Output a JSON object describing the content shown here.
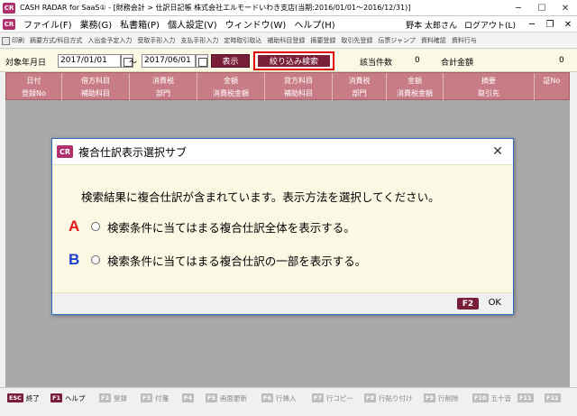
{
  "window": {
    "icon_text": "CR",
    "title": "CASH RADAR for SaaS① - [財務会計 > 仕訳日記帳 株式会社エルモードいわき支店(当期:2016/01/01～2016/12/31)]",
    "minimize": "─",
    "maximize": "☐",
    "close": "✕"
  },
  "menu": {
    "items": [
      "ファイル(F)",
      "業務(G)",
      "私書箱(P)",
      "個人設定(V)",
      "ウィンドウ(W)",
      "ヘルプ(H)"
    ],
    "user": "野本 太郎さん",
    "logout": "ログアウト(L)",
    "min": "─",
    "restore": "❐",
    "close": "✕"
  },
  "toolbar": {
    "items": [
      "印刷",
      "摘要方式/科目方式",
      "入出金予定入力",
      "受取手形入力",
      "支払手形入力",
      "定時取引取込",
      "補助科目登録",
      "摘要登録",
      "取引先登録",
      "伝票ジャンプ",
      "資料確認",
      "資料行与"
    ]
  },
  "search": {
    "period_label": "対象年月日",
    "date_from": "2017/01/01",
    "tilde": "～",
    "date_to": "2017/06/01",
    "display_button": "表示",
    "filter_button": "絞り込み検索",
    "count_label": "該当件数",
    "count_value": "0",
    "total_label": "合計金額",
    "total_value": "0"
  },
  "grid": {
    "columns": [
      {
        "r1": "日付",
        "r2": "登録No"
      },
      {
        "r1": "借方科目",
        "r2": "補助科目"
      },
      {
        "r1": "消費税",
        "r2": "部門"
      },
      {
        "r1": "金額",
        "r2": "消費税金額"
      },
      {
        "r1": "貸方科目",
        "r2": "補助科目"
      },
      {
        "r1": "消費税",
        "r2": "部門"
      },
      {
        "r1": "金額",
        "r2": "消費税金額"
      },
      {
        "r1": "摘要",
        "r2": "取引先"
      },
      {
        "r1": "証No",
        "r2": ""
      }
    ]
  },
  "dialog": {
    "icon_text": "CR",
    "title": "複合仕訳表示選択サブ",
    "close": "✕",
    "message": "検索結果に複合仕訳が含まれています。表示方法を選択してください。",
    "options": [
      {
        "letter": "A",
        "label": "検索条件に当てはまる複合仕訳全体を表示する。",
        "color": "#e01818"
      },
      {
        "letter": "B",
        "label": "検索条件に当てはまる複合仕訳の一部を表示する。",
        "color": "#1c3fd0"
      }
    ],
    "f2_key": "F2",
    "ok": "OK"
  },
  "fkeys": [
    {
      "key": "ESC",
      "label": "終了",
      "enabled": true
    },
    {
      "key": "F1",
      "label": "ヘルプ",
      "enabled": true
    },
    {
      "key": "F2",
      "label": "登録",
      "enabled": false
    },
    {
      "key": "F3",
      "label": "付箋",
      "enabled": false
    },
    {
      "key": "F4",
      "label": "",
      "enabled": false
    },
    {
      "key": "F5",
      "label": "画面更新",
      "enabled": false
    },
    {
      "key": "F6",
      "label": "行挿入",
      "enabled": false
    },
    {
      "key": "F7",
      "label": "行コピー",
      "enabled": false
    },
    {
      "key": "F8",
      "label": "行貼り付け",
      "enabled": false
    },
    {
      "key": "F9",
      "label": "行削除",
      "enabled": false
    },
    {
      "key": "F10",
      "label": "五十音",
      "enabled": false
    },
    {
      "key": "F11",
      "label": "",
      "enabled": false
    },
    {
      "key": "F12",
      "label": "",
      "enabled": false
    }
  ]
}
